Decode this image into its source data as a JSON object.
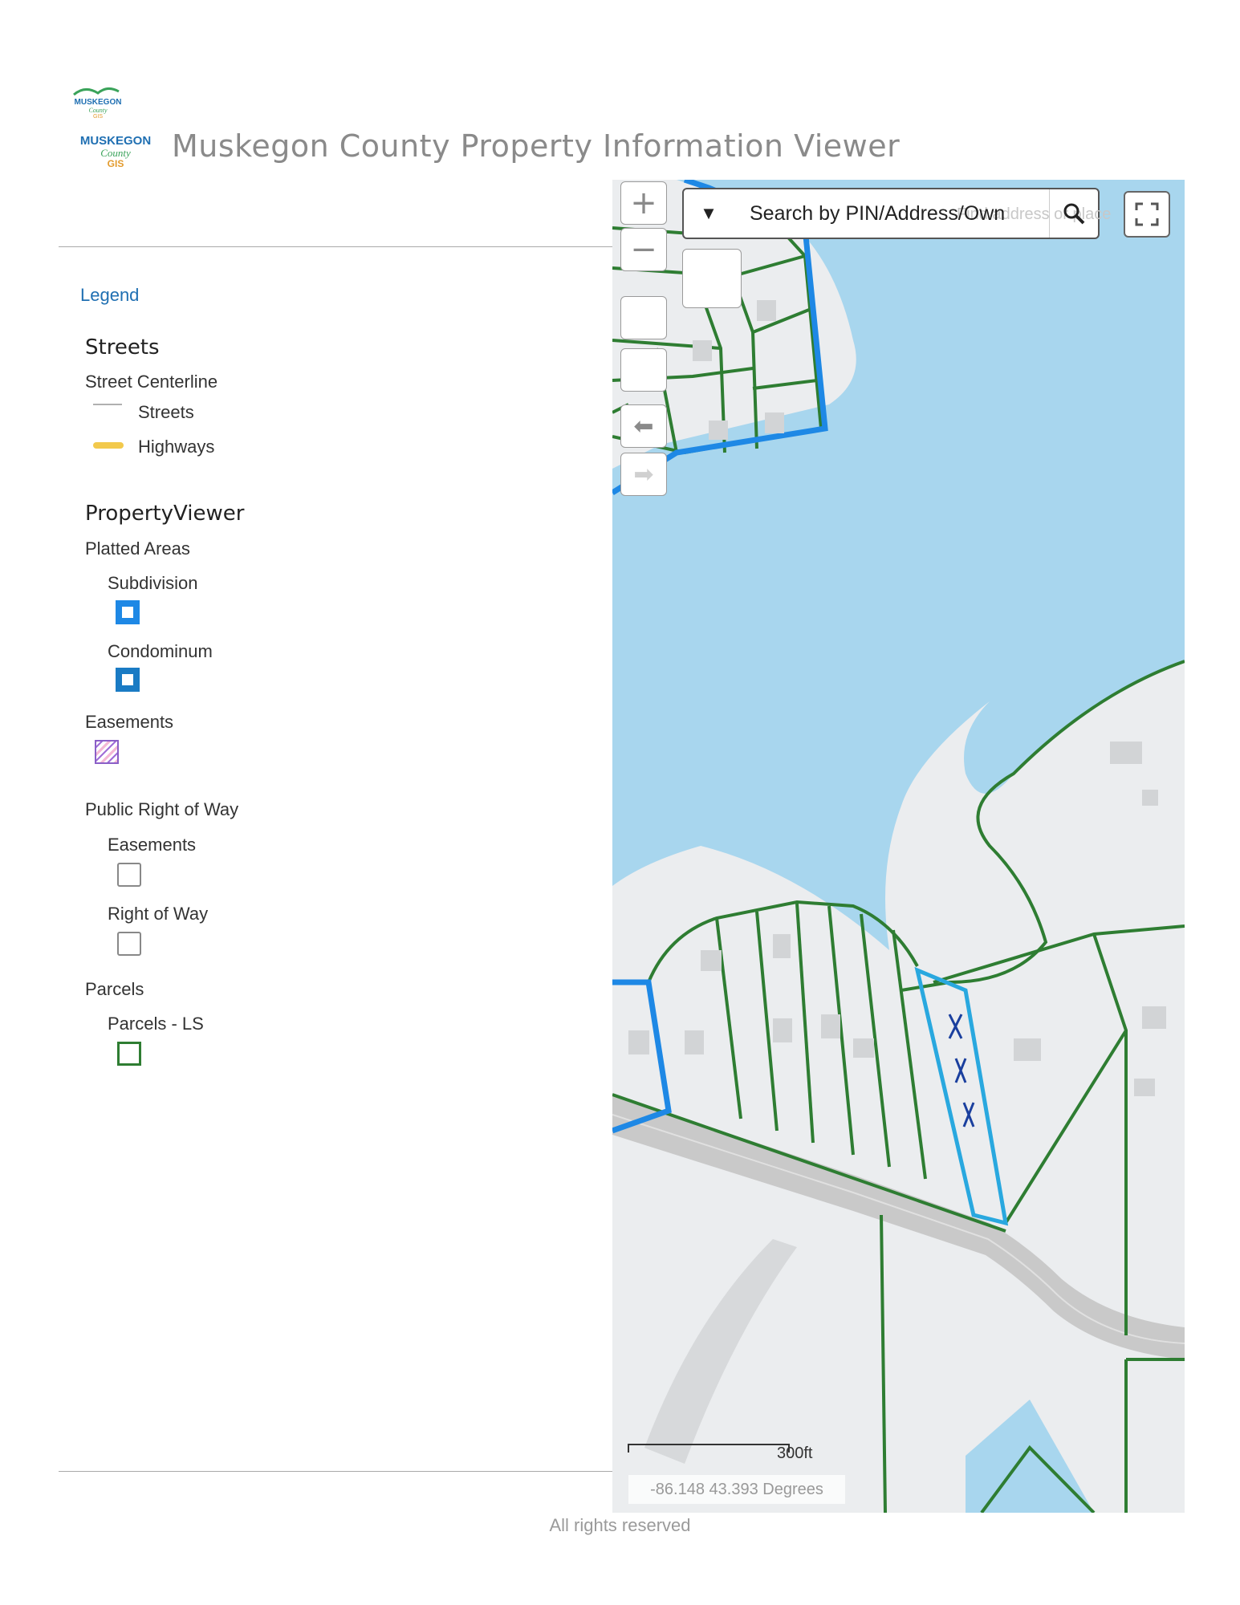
{
  "header": {
    "small_logo_text": "MUSKEGON County GIS",
    "logo_text_top": "MUSKEGON",
    "logo_text_mid": "County",
    "logo_text_bottom": "GIS",
    "title": "Muskegon County Property Information Viewer"
  },
  "legend": {
    "title": "Legend",
    "streets": {
      "layer_title": "Streets",
      "group_title": "Street Centerline",
      "items": [
        {
          "label": "Streets",
          "color": "#b0b0b0"
        },
        {
          "label": "Highways",
          "color": "#f2c94c"
        }
      ]
    },
    "property_viewer": {
      "layer_title": "PropertyViewer",
      "platted_areas": {
        "group_title": "Platted Areas",
        "items": [
          {
            "label": "Subdivision",
            "color": "#1e88e5"
          },
          {
            "label": "Condominum",
            "color": "#1a7bc4"
          }
        ]
      },
      "easements": {
        "group_title": "Easements",
        "color": "#a06ed8"
      },
      "public_right_of_way": {
        "group_title": "Public Right of Way",
        "items": [
          {
            "label": "Easements",
            "color": "#888888"
          },
          {
            "label": "Right of Way",
            "color": "#888888"
          }
        ]
      },
      "parcels": {
        "group_title": "Parcels",
        "items": [
          {
            "label": "Parcels - LS",
            "color": "#2e7d32"
          }
        ]
      }
    }
  },
  "map": {
    "search": {
      "placeholder": "Search by PIN/Address/Own",
      "hint": "Find address or place"
    },
    "scale_label": "300ft",
    "coordinates": "-86.148 43.393 Degrees",
    "colors": {
      "water": "#a8d6ee",
      "land": "#ebedef",
      "parcel_line": "#2e7d32",
      "subdivision_line": "#1e88e5",
      "selected_parcel": "#29a8df",
      "road": "#c9c9c9"
    }
  },
  "footer": {
    "text": "All rights reserved"
  }
}
